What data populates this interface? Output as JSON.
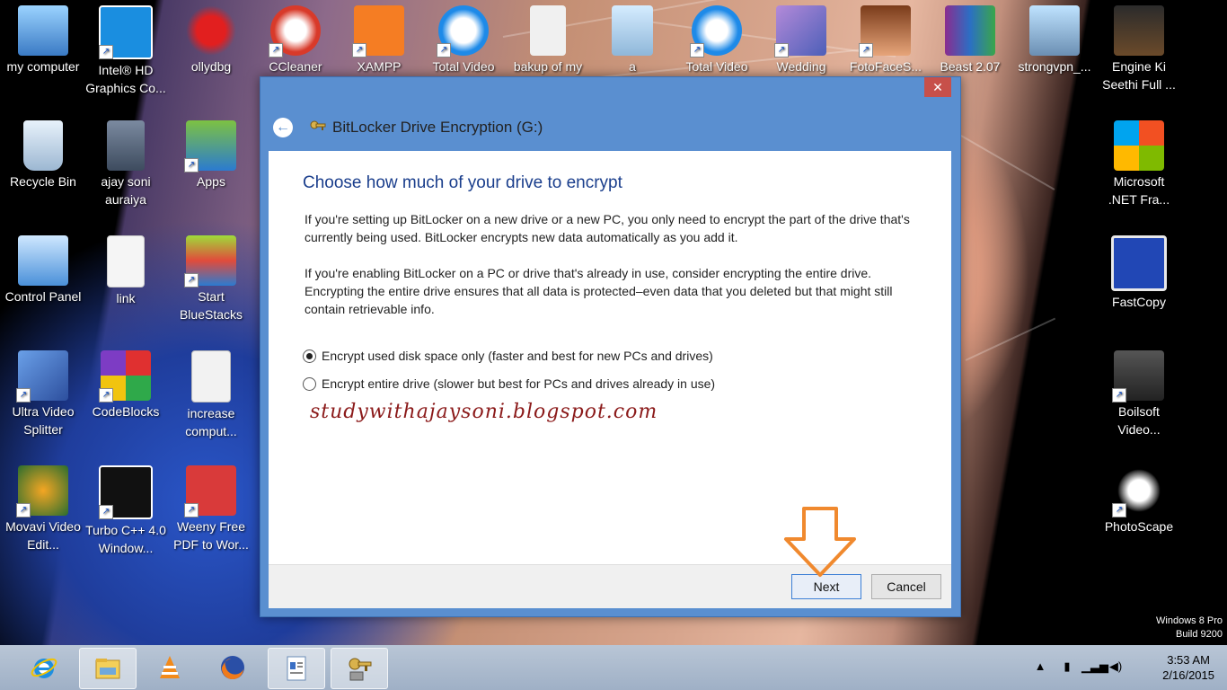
{
  "desktop": {
    "left_icons": [
      {
        "label": "my computer",
        "icon": "computer-icon"
      },
      {
        "label": "Intel® HD Graphics Co...",
        "icon": "intel-icon"
      },
      {
        "label": "Recycle Bin",
        "icon": "recycle-bin-icon"
      },
      {
        "label": "ajay soni auraiya",
        "icon": "photo-icon"
      },
      {
        "label": "Control Panel",
        "icon": "control-panel-icon"
      },
      {
        "label": "link",
        "icon": "document-icon"
      },
      {
        "label": "Ultra Video Splitter",
        "icon": "video-splitter-icon"
      },
      {
        "label": "CodeBlocks",
        "icon": "codeblocks-icon"
      },
      {
        "label": "Movavi Video Edit...",
        "icon": "movavi-icon"
      },
      {
        "label": "Turbo C++ 4.0 Window...",
        "icon": "turbo-cpp-icon"
      }
    ],
    "mid_icons": [
      {
        "label": "Apps",
        "icon": "bluestacks-apps-icon"
      },
      {
        "label": "Start BlueStacks",
        "icon": "bluestacks-icon"
      },
      {
        "label": "increase comput...",
        "icon": "text-document-icon"
      },
      {
        "label": "Weeny Free PDF to Wor...",
        "icon": "pdf-converter-icon"
      }
    ],
    "top_icons": [
      {
        "label": "ollydbg",
        "icon": "ollydbg-icon"
      },
      {
        "label": "CCleaner",
        "icon": "ccleaner-icon"
      },
      {
        "label": "XAMPP",
        "icon": "xampp-icon"
      },
      {
        "label": "Total Video",
        "icon": "total-video-icon"
      },
      {
        "label": "bakup of my",
        "icon": "blank-file-icon"
      },
      {
        "label": "a",
        "icon": "notepad-icon"
      },
      {
        "label": "Total Video",
        "icon": "total-video-player-icon"
      },
      {
        "label": "Wedding",
        "icon": "wedding-icon"
      },
      {
        "label": "FotoFaceS...",
        "icon": "fotoface-icon"
      },
      {
        "label": "Beast 2.07",
        "icon": "winrar-icon"
      },
      {
        "label": "strongvpn_...",
        "icon": "installer-icon"
      }
    ],
    "right_icons": [
      {
        "label": "Engine Ki Seethi Full ...",
        "icon": "video-file-icon"
      },
      {
        "label": "Microsoft .NET Fra...",
        "icon": "windows-logo-icon"
      },
      {
        "label": "FastCopy",
        "icon": "fastcopy-icon"
      },
      {
        "label": "Boilsoft Video...",
        "icon": "boilsoft-icon"
      },
      {
        "label": "PhotoScape",
        "icon": "photoscape-icon"
      }
    ]
  },
  "dialog": {
    "title": "BitLocker Drive Encryption (G:)",
    "close_glyph": "✕",
    "back_glyph": "←",
    "heading": "Choose how much of your drive to encrypt",
    "para1": "If you're setting up BitLocker on a new drive or a new PC, you only need to encrypt the part of the drive that's currently being used. BitLocker encrypts new data automatically as you add it.",
    "para2": "If you're enabling BitLocker on a PC or drive that's already in use, consider encrypting the entire drive. Encrypting the entire drive ensures that all data is protected–even data that you deleted but that might still contain retrievable info.",
    "options": [
      {
        "label": "Encrypt used disk space only (faster and best for new PCs and drives)",
        "checked": true
      },
      {
        "label": "Encrypt entire drive (slower but best for PCs and drives already in use)",
        "checked": false
      }
    ],
    "watermark": "studywithajaysoni.blogspot.com",
    "next_label": "Next",
    "cancel_label": "Cancel"
  },
  "windows_version": {
    "line1": "Windows 8 Pro",
    "line2": "Build 9200"
  },
  "taskbar": {
    "items": [
      "internet-explorer-icon",
      "file-explorer-icon",
      "vlc-icon",
      "firefox-icon",
      "wordpad-icon",
      "bitlocker-icon"
    ],
    "time": "3:53 AM",
    "date": "2/16/2015"
  },
  "colors": {
    "accent": "#5a8fd0",
    "heading": "#1a3e8c",
    "arrow": "#f0892e",
    "watermark": "#8b1a1a"
  }
}
